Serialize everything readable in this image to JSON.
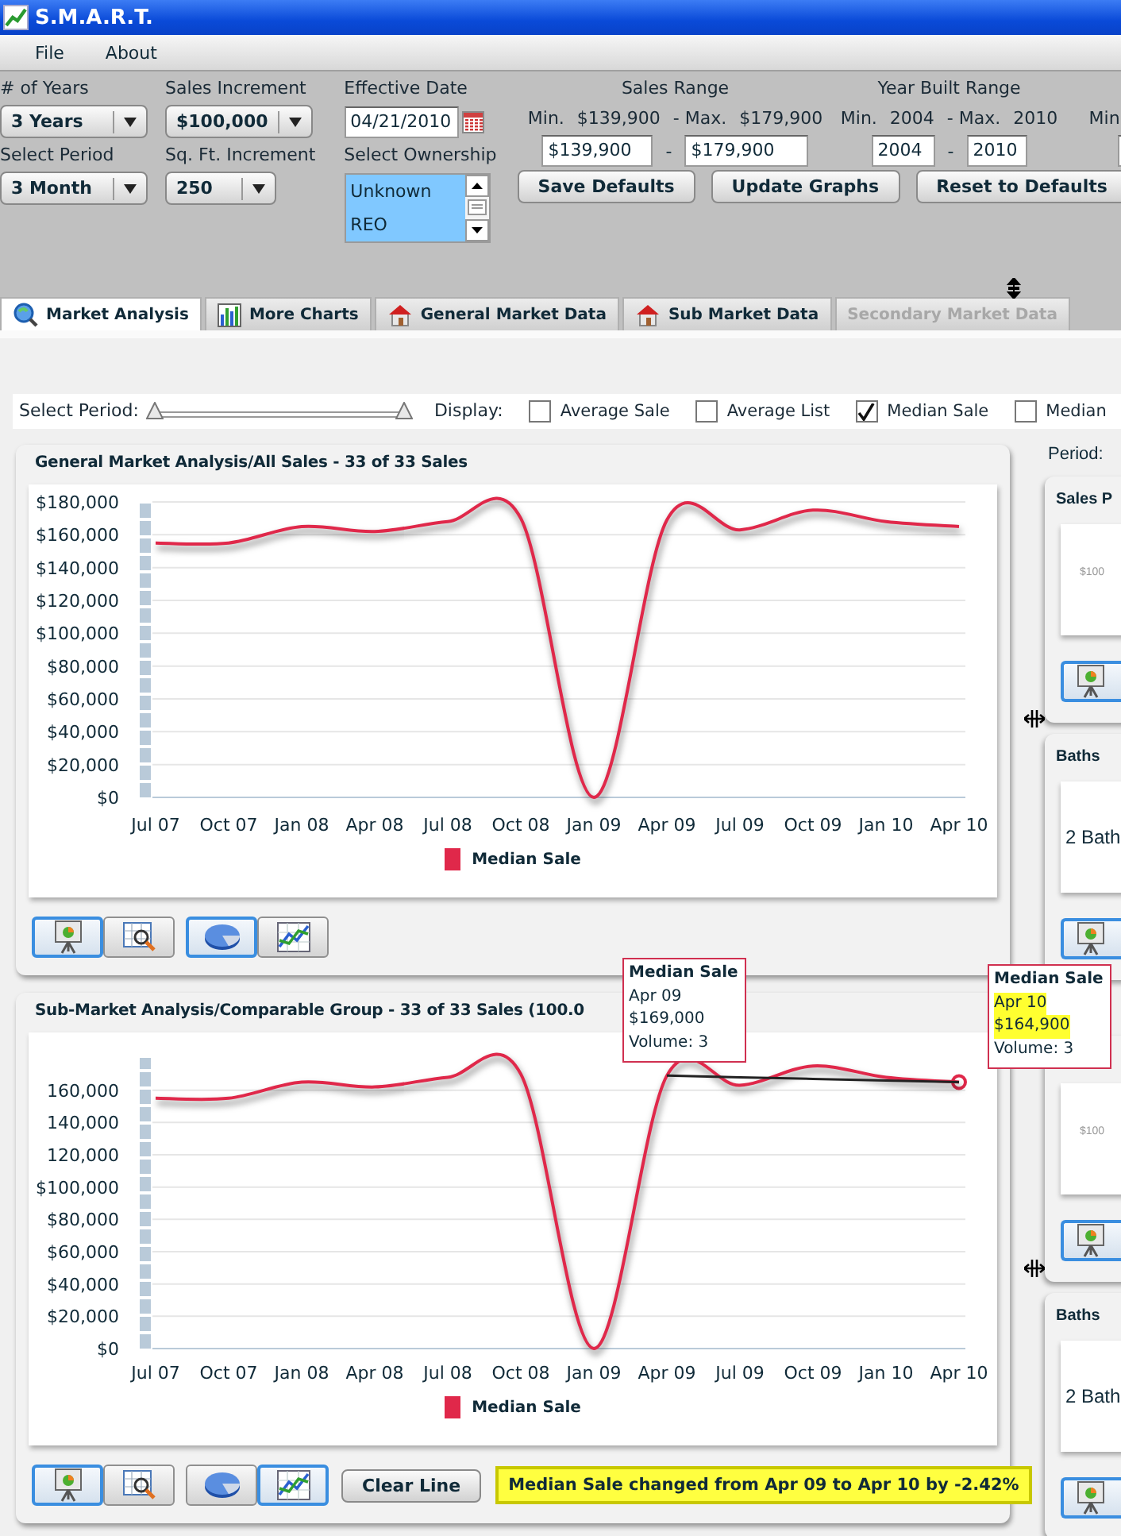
{
  "window": {
    "title": "S.M.A.R.T."
  },
  "menu": [
    {
      "label": "File"
    },
    {
      "label": "About"
    }
  ],
  "selectors": [
    {
      "label": "# of Years",
      "value": "3 Years"
    },
    {
      "label": "Select Period",
      "value": "3 Month"
    },
    {
      "label": "Sales Increment",
      "value": "$100,000"
    },
    {
      "label": "Sq. Ft. Increment",
      "value": "250"
    }
  ],
  "effective_date": {
    "label": "Effective Date",
    "value": "04/21/2010"
  },
  "ownership": {
    "label": "Select Ownership",
    "options": [
      {
        "label": "Unknown",
        "selected": true
      },
      {
        "label": "REO",
        "selected": true
      }
    ]
  },
  "ranges": [
    {
      "title": "Sales Range",
      "min_label": "Min.",
      "min": "$139,900",
      "max_label": "- Max.",
      "max": "$179,900",
      "from": "$139,900",
      "separator": "-",
      "to": "$179,900"
    },
    {
      "title": "Year Built Range",
      "min_label": "Min.",
      "min": "2004",
      "max_label": "- Max.",
      "max": "2010",
      "from": "2004",
      "separator": "-",
      "to": "2010"
    },
    {
      "min_label": "Min."
    }
  ],
  "buttons": [
    "Save Defaults",
    "Update Graphs",
    "Reset to Defaults"
  ],
  "tabs": [
    {
      "label": "Market Analysis",
      "kind": "search",
      "selected": true,
      "disabled": false
    },
    {
      "label": "More Charts",
      "kind": "bars",
      "selected": false,
      "disabled": false
    },
    {
      "label": "General Market Data",
      "kind": "house",
      "selected": false,
      "disabled": false
    },
    {
      "label": "Sub Market Data",
      "kind": "house",
      "selected": false,
      "disabled": false
    },
    {
      "label": "Secondary Market Data",
      "kind": "none",
      "selected": false,
      "disabled": true
    }
  ],
  "period": {
    "label": "Select Period:",
    "thumbs": [
      {
        "level": 0
      },
      {
        "level": 1
      }
    ]
  },
  "display": {
    "label": "Display:",
    "options": [
      {
        "label": "Average Sale",
        "checked": false
      },
      {
        "label": "Average List",
        "checked": false
      },
      {
        "label": "Median Sale",
        "checked": true
      },
      {
        "label": "Median",
        "checked": false
      }
    ]
  },
  "charts": [
    {
      "title": "General Market Analysis/All Sales - 33 of 33 Sales",
      "chart_data": {
        "type": "line",
        "grid": true,
        "categories": [
          "Jul 07",
          "Oct 07",
          "Jan 08",
          "Apr 08",
          "Jul 08",
          "Oct 08",
          "Jan 09",
          "Apr 09",
          "Jul 09",
          "Oct 09",
          "Jan 10",
          "Apr 10"
        ],
        "series": [
          {
            "name": "Median Sale",
            "color": "#e0284a",
            "values": [
              155000,
              155000,
              165000,
              162000,
              168000,
              170000,
              0,
              169000,
              163000,
              175000,
              168000,
              165000
            ]
          }
        ],
        "ylim": [
          0,
          180000
        ],
        "yticks": [
          {
            "value": 0,
            "label": "$0"
          },
          {
            "value": 20000,
            "label": "$20,000"
          },
          {
            "value": 40000,
            "label": "$40,000"
          },
          {
            "value": 60000,
            "label": "$60,000"
          },
          {
            "value": 80000,
            "label": "$80,000"
          },
          {
            "value": 100000,
            "label": "$100,000"
          },
          {
            "value": 120000,
            "label": "$120,000"
          },
          {
            "value": 140000,
            "label": "$140,000"
          },
          {
            "value": 160000,
            "label": "$160,000"
          },
          {
            "value": 180000,
            "label": "$180,000"
          }
        ]
      },
      "tool_groups": [
        [
          {
            "kind": "presentation",
            "selected": true
          },
          {
            "kind": "zoom",
            "selected": false
          }
        ],
        [
          {
            "kind": "pie",
            "selected": true
          },
          {
            "kind": "line",
            "selected": false
          }
        ]
      ]
    },
    {
      "title": "Sub-Market Analysis/Comparable Group - 33 of 33 Sales (100.0",
      "chart_data": {
        "type": "line",
        "grid": true,
        "categories": [
          "Jul 07",
          "Oct 07",
          "Jan 08",
          "Apr 08",
          "Jul 08",
          "Oct 08",
          "Jan 09",
          "Apr 09",
          "Jul 09",
          "Oct 09",
          "Jan 10",
          "Apr 10"
        ],
        "series": [
          {
            "name": "Median Sale",
            "color": "#e0284a",
            "values": [
              155000,
              155000,
              165000,
              162000,
              168000,
              170000,
              0,
              169000,
              163000,
              175000,
              168000,
              165000
            ]
          },
          {
            "color": "#222222",
            "values": [
              null,
              null,
              null,
              null,
              null,
              null,
              null,
              169000,
              168000,
              167000,
              166000,
              165000
            ]
          }
        ],
        "ylim": [
          0,
          180000
        ],
        "yticks": [
          {
            "value": 0,
            "label": "$0"
          },
          {
            "value": 20000,
            "label": "$20,000"
          },
          {
            "value": 40000,
            "label": "$40,000"
          },
          {
            "value": 60000,
            "label": "$60,000"
          },
          {
            "value": 80000,
            "label": "$80,000"
          },
          {
            "value": 100000,
            "label": "$100,000"
          },
          {
            "value": 120000,
            "label": "120,000"
          },
          {
            "value": 140000,
            "label": "140,000"
          },
          {
            "value": 160000,
            "label": "160,000"
          }
        ]
      },
      "tool_groups": [
        [
          {
            "kind": "presentation",
            "selected": true
          },
          {
            "kind": "zoom",
            "selected": false
          }
        ],
        [
          {
            "kind": "pie",
            "selected": false
          },
          {
            "kind": "line",
            "selected": true
          }
        ]
      ],
      "clear_button": "Clear Line",
      "message": "Median Sale changed from Apr 09 to Apr 10 by -2.42%",
      "tooltips": [
        {
          "lines": [
            {
              "text": "Median Sale",
              "kind": "title",
              "highlighted": false
            },
            {
              "text": "Apr 09",
              "kind": "text",
              "highlighted": false
            },
            {
              "text": "$169,000",
              "kind": "text",
              "highlighted": false
            },
            {
              "text": "Volume: 3",
              "kind": "text",
              "highlighted": false
            }
          ]
        },
        {
          "lines": [
            {
              "text": "Median Sale",
              "kind": "title",
              "highlighted": false
            },
            {
              "text": "Apr 10",
              "kind": "text",
              "highlighted": true
            },
            {
              "text": "$164,900",
              "kind": "text",
              "highlighted": true
            },
            {
              "text": "Volume: 3",
              "kind": "text",
              "highlighted": false
            }
          ]
        }
      ]
    }
  ],
  "side": {
    "period_label": "Period:",
    "panels": [
      {
        "title": "Sales P",
        "content": "$100",
        "kind": "chart"
      },
      {
        "title": "Baths",
        "content": "2 Bath",
        "kind": "text"
      },
      {
        "content": "$100",
        "kind": "chart"
      },
      {
        "title": "Baths",
        "content": "2 Bath",
        "kind": "text"
      }
    ]
  }
}
